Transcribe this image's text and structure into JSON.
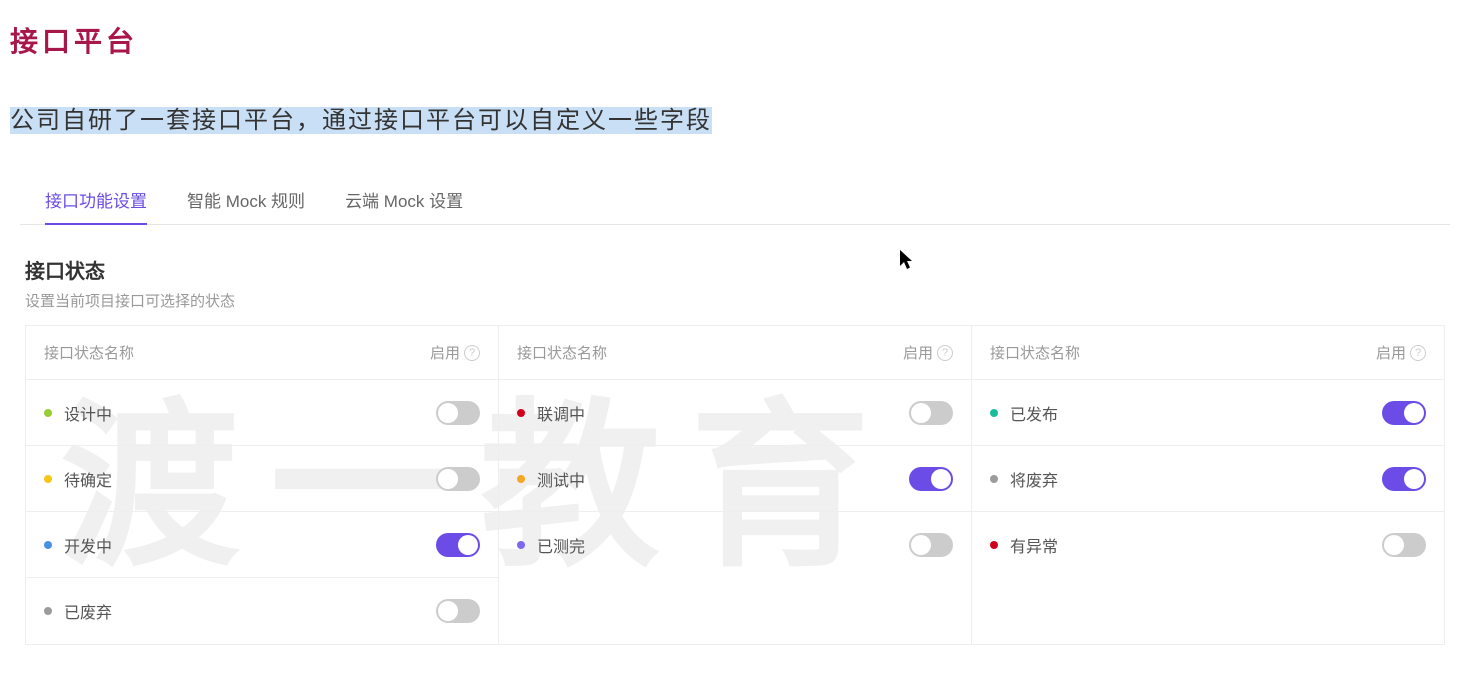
{
  "page": {
    "title": "接口平台",
    "description": "公司自研了一套接口平台，通过接口平台可以自定义一些字段"
  },
  "tabs": [
    {
      "label": "接口功能设置",
      "active": true
    },
    {
      "label": "智能 Mock 规则",
      "active": false
    },
    {
      "label": "云端 Mock 设置",
      "active": false
    }
  ],
  "section": {
    "title": "接口状态",
    "subtitle": "设置当前项目接口可选择的状态",
    "header_name": "接口状态名称",
    "header_enable": "启用"
  },
  "watermark": "渡一教育",
  "colors": {
    "accent": "#6b4ce6",
    "title": "#a8174a",
    "highlight": "#c9dff5"
  },
  "status_columns": [
    {
      "rows": [
        {
          "label": "设计中",
          "dot": "#9acd32",
          "enabled": false
        },
        {
          "label": "待确定",
          "dot": "#f5c518",
          "enabled": false
        },
        {
          "label": "开发中",
          "dot": "#4a90e2",
          "enabled": true
        },
        {
          "label": "已废弃",
          "dot": "#9b9b9b",
          "enabled": false
        }
      ]
    },
    {
      "rows": [
        {
          "label": "联调中",
          "dot": "#d0021b",
          "enabled": false
        },
        {
          "label": "测试中",
          "dot": "#f5a623",
          "enabled": true
        },
        {
          "label": "已测完",
          "dot": "#7b68ee",
          "enabled": false
        }
      ]
    },
    {
      "rows": [
        {
          "label": "已发布",
          "dot": "#1abc9c",
          "enabled": true
        },
        {
          "label": "将废弃",
          "dot": "#9b9b9b",
          "enabled": true
        },
        {
          "label": "有异常",
          "dot": "#d0021b",
          "enabled": false
        }
      ]
    }
  ]
}
